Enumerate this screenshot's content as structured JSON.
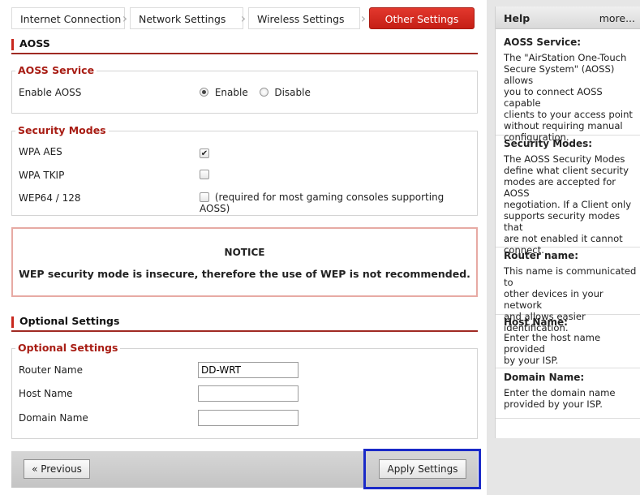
{
  "tabs": [
    "Internet Connection",
    "Network Settings",
    "Wireless Settings",
    "Other Settings"
  ],
  "aoss": {
    "section_title": "AOSS",
    "service_legend": "AOSS Service",
    "enable_label": "Enable AOSS",
    "enable_option": "Enable",
    "disable_option": "Disable",
    "selected": "Enable",
    "security_legend": "Security Modes",
    "modes": [
      {
        "label": "WPA AES",
        "checked": true,
        "note": ""
      },
      {
        "label": "WPA TKIP",
        "checked": false,
        "note": ""
      },
      {
        "label": "WEP64 / 128",
        "checked": false,
        "note": "(required for most gaming consoles supporting AOSS)"
      }
    ]
  },
  "notice": {
    "title": "NOTICE",
    "message": "WEP security mode is insecure, therefore the use of WEP is not recommended."
  },
  "optional": {
    "section_title": "Optional Settings",
    "legend": "Optional Settings",
    "router_name_label": "Router Name",
    "router_name_value": "DD-WRT",
    "host_name_label": "Host Name",
    "host_name_value": "",
    "domain_name_label": "Domain Name",
    "domain_name_value": ""
  },
  "footer": {
    "previous_label": "« Previous",
    "apply_label": "Apply Settings"
  },
  "help": {
    "title": "Help",
    "more_label": "more...",
    "sections": [
      {
        "title": "AOSS Service:",
        "body": "The \"AirStation One-Touch\nSecure System\" (AOSS) allows\nyou to connect AOSS capable\nclients to your access point\nwithout requiring manual\nconfiguration."
      },
      {
        "title": "Security Modes:",
        "body": "The AOSS Security Modes\ndefine what client security\nmodes are accepted for AOSS\nnegotiation. If a Client only\nsupports security modes that\nare not enabled it cannot\nconnect."
      },
      {
        "title": "Router name:",
        "body": "This name is communicated to\nother devices in your network\nand allows easier identification."
      },
      {
        "title": "Host Name:",
        "body": "Enter the host name provided\nby your ISP."
      },
      {
        "title": "Domain Name:",
        "body": "Enter the domain name\nprovided by your ISP."
      }
    ]
  }
}
